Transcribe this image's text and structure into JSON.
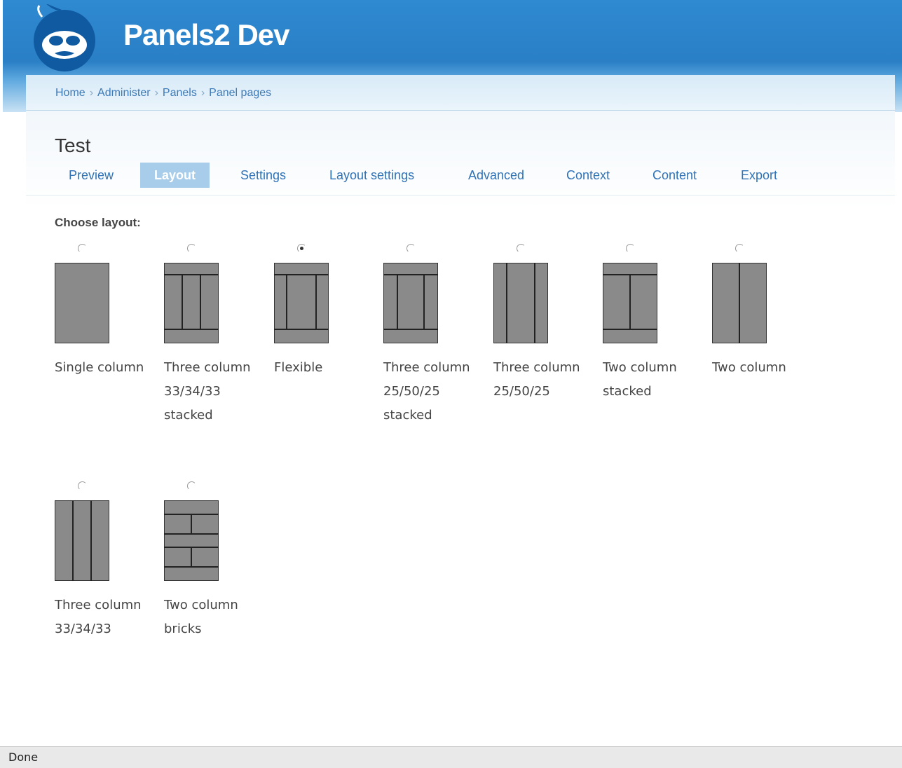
{
  "site": {
    "name": "Panels2 Dev"
  },
  "breadcrumb": [
    "Home",
    "Administer",
    "Panels",
    "Panel pages"
  ],
  "page": {
    "title": "Test"
  },
  "tabs": [
    {
      "label": "Preview",
      "active": false
    },
    {
      "label": "Layout",
      "active": true
    },
    {
      "label": "Settings",
      "active": false
    },
    {
      "label": "Layout settings",
      "active": false
    },
    {
      "label": "Advanced",
      "active": false
    },
    {
      "label": "Context",
      "active": false
    },
    {
      "label": "Content",
      "active": false
    },
    {
      "label": "Export",
      "active": false
    }
  ],
  "layout_chooser": {
    "label": "Choose layout:",
    "options": [
      {
        "label": "Single column",
        "selected": false,
        "icon": "single-column-icon"
      },
      {
        "label": "Three column\n33/34/33\nstacked",
        "selected": false,
        "icon": "three-column-33-34-33-stacked-icon"
      },
      {
        "label": "Flexible",
        "selected": true,
        "icon": "flexible-icon"
      },
      {
        "label": "Three column\n25/50/25\nstacked",
        "selected": false,
        "icon": "three-column-25-50-25-stacked-icon"
      },
      {
        "label": "Three column\n25/50/25",
        "selected": false,
        "icon": "three-column-25-50-25-icon"
      },
      {
        "label": "Two column\nstacked",
        "selected": false,
        "icon": "two-column-stacked-icon"
      },
      {
        "label": "Two column",
        "selected": false,
        "icon": "two-column-icon"
      },
      {
        "label": "Three column\n33/34/33",
        "selected": false,
        "icon": "three-column-33-34-33-icon"
      },
      {
        "label": "Two column\nbricks",
        "selected": false,
        "icon": "two-column-bricks-icon"
      }
    ]
  },
  "statusbar": {
    "text": "Done"
  },
  "colors": {
    "header_blue": "#2a7fc5",
    "link_blue": "#2f72b6",
    "active_tab": "#a8cdea",
    "thumb_gray": "#8a8a8a"
  }
}
